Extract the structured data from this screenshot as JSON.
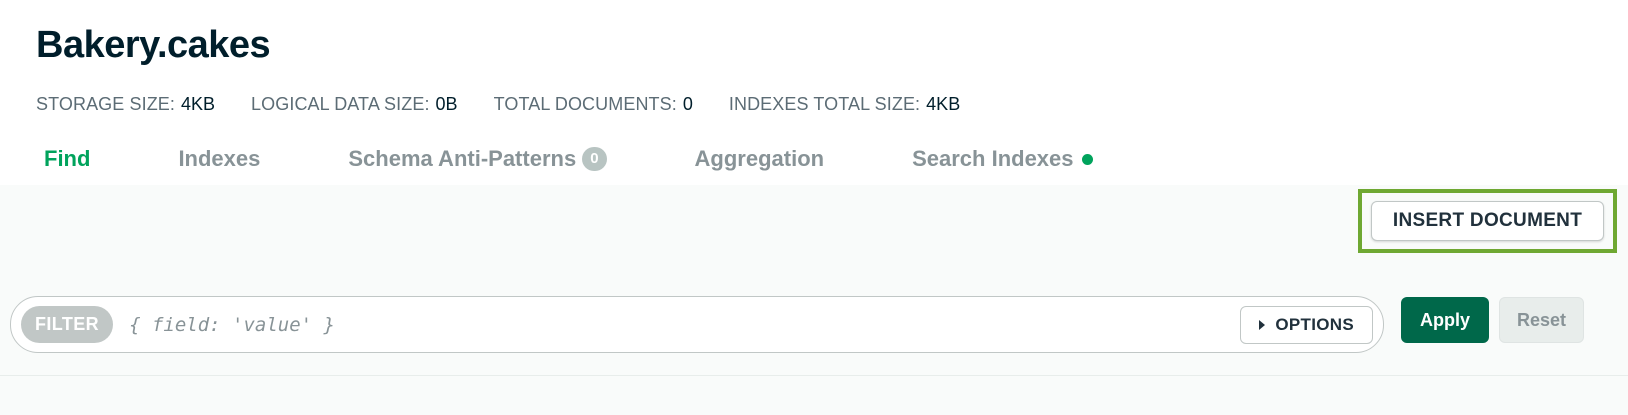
{
  "collection": {
    "title": "Bakery.cakes"
  },
  "stats": [
    {
      "label": "STORAGE SIZE:",
      "value": "4KB"
    },
    {
      "label": "LOGICAL DATA SIZE:",
      "value": "0B"
    },
    {
      "label": "TOTAL DOCUMENTS:",
      "value": "0"
    },
    {
      "label": "INDEXES TOTAL SIZE:",
      "value": "4KB"
    }
  ],
  "tabs": [
    {
      "label": "Find",
      "active": true
    },
    {
      "label": "Indexes"
    },
    {
      "label": "Schema Anti-Patterns",
      "badge": "0"
    },
    {
      "label": "Aggregation"
    },
    {
      "label": "Search Indexes",
      "status_dot_color": "#00a35c"
    }
  ],
  "toolbar": {
    "insert_label": "INSERT DOCUMENT"
  },
  "filter": {
    "pill_label": "FILTER",
    "placeholder": "{ field: 'value' }",
    "value": "",
    "options_label": "OPTIONS",
    "apply_label": "Apply",
    "reset_label": "Reset"
  },
  "colors": {
    "accent": "#00a35c",
    "apply": "#00684a",
    "highlight": "#6fa832"
  }
}
